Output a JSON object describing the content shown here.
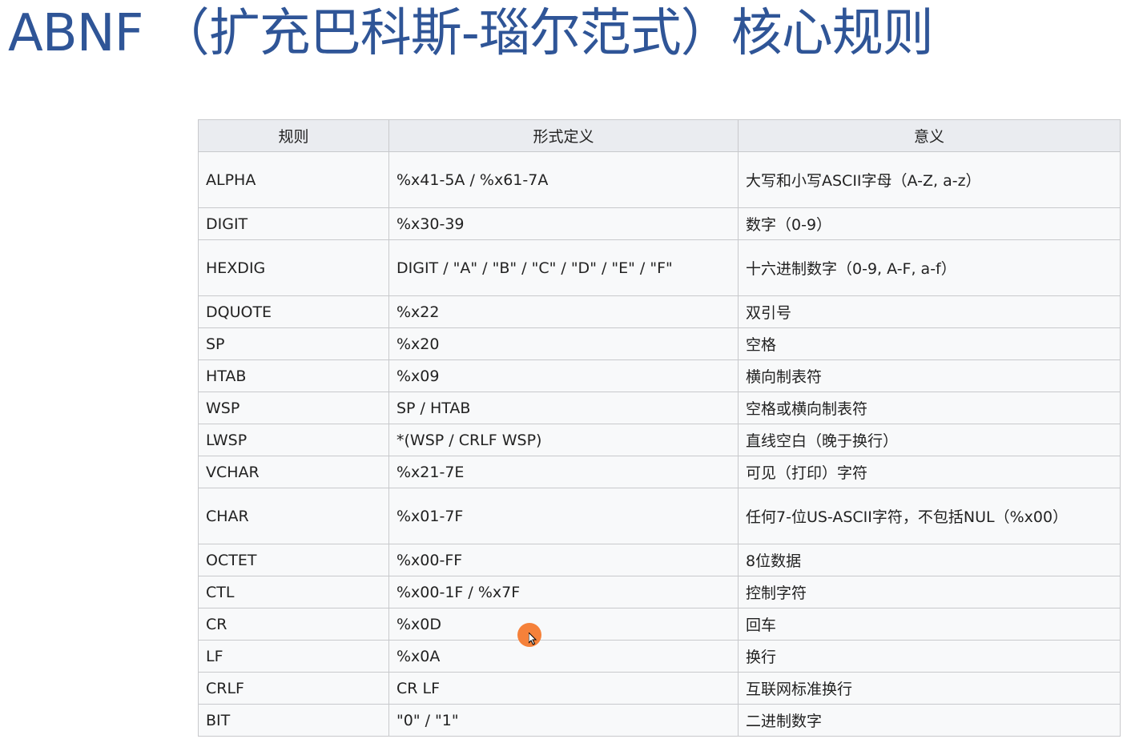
{
  "slide": {
    "title": "ABNF （扩充巴科斯-瑙尔范式）核心规则"
  },
  "table": {
    "headers": [
      "规则",
      "形式定义",
      "意义"
    ],
    "rows": [
      {
        "rule": "ALPHA",
        "definition": "%x41-5A / %x61-7A",
        "meaning": "大写和小写ASCII字母（A-Z, a-z）",
        "tall": true
      },
      {
        "rule": "DIGIT",
        "definition": "%x30-39",
        "meaning": "数字（0-9）",
        "tall": false
      },
      {
        "rule": "HEXDIG",
        "definition": "DIGIT / \"A\" / \"B\" / \"C\" / \"D\" / \"E\" / \"F\"",
        "meaning": "十六进制数字（0-9, A-F, a-f）",
        "tall": true
      },
      {
        "rule": "DQUOTE",
        "definition": "%x22",
        "meaning": "双引号",
        "tall": false
      },
      {
        "rule": "SP",
        "definition": "%x20",
        "meaning": "空格",
        "tall": false
      },
      {
        "rule": "HTAB",
        "definition": "%x09",
        "meaning": "横向制表符",
        "tall": false
      },
      {
        "rule": "WSP",
        "definition": "SP / HTAB",
        "meaning": "空格或横向制表符",
        "tall": false
      },
      {
        "rule": "LWSP",
        "definition": "*(WSP / CRLF WSP)",
        "meaning": "直线空白（晚于换行）",
        "tall": false
      },
      {
        "rule": "VCHAR",
        "definition": "%x21-7E",
        "meaning": "可见（打印）字符",
        "tall": false
      },
      {
        "rule": "CHAR",
        "definition": "%x01-7F",
        "meaning": "任何7-位US-ASCII字符，不包括NUL（%x00）",
        "tall": true
      },
      {
        "rule": "OCTET",
        "definition": "%x00-FF",
        "meaning": "8位数据",
        "tall": false
      },
      {
        "rule": "CTL",
        "definition": "%x00-1F / %x7F",
        "meaning": "控制字符",
        "tall": false
      },
      {
        "rule": "CR",
        "definition": "%x0D",
        "meaning": "回车",
        "tall": false
      },
      {
        "rule": "LF",
        "definition": "%x0A",
        "meaning": "换行",
        "tall": false
      },
      {
        "rule": "CRLF",
        "definition": "CR LF",
        "meaning": "互联网标准换行",
        "tall": false
      },
      {
        "rule": "BIT",
        "definition": "\"0\" / \"1\"",
        "meaning": "二进制数字",
        "tall": false
      }
    ]
  },
  "colors": {
    "title": "#2f5597",
    "cursor_highlight": "#f5813a"
  }
}
